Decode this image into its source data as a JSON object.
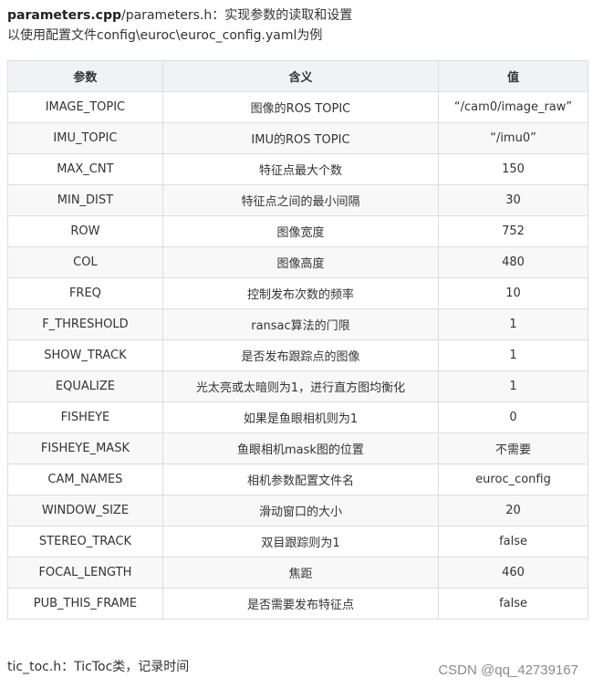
{
  "intro": {
    "file_bold": "parameters.cpp",
    "file_rest": "/parameters.h",
    "desc": "：实现参数的读取和设置",
    "line2": "以使用配置文件config\\euroc\\euroc_config.yaml为例"
  },
  "table": {
    "headers": [
      "参数",
      "含义",
      "值"
    ],
    "rows": [
      [
        "IMAGE_TOPIC",
        "图像的ROS TOPIC",
        "“/cam0/image_raw”"
      ],
      [
        "IMU_TOPIC",
        "IMU的ROS TOPIC",
        "“/imu0”"
      ],
      [
        "MAX_CNT",
        "特征点最大个数",
        "150"
      ],
      [
        "MIN_DIST",
        "特征点之间的最小间隔",
        "30"
      ],
      [
        "ROW",
        "图像宽度",
        "752"
      ],
      [
        "COL",
        "图像高度",
        "480"
      ],
      [
        "FREQ",
        "控制发布次数的频率",
        "10"
      ],
      [
        "F_THRESHOLD",
        "ransac算法的门限",
        "1"
      ],
      [
        "SHOW_TRACK",
        "是否发布跟踪点的图像",
        "1"
      ],
      [
        "EQUALIZE",
        "光太亮或太暗则为1，进行直方图均衡化",
        "1"
      ],
      [
        "FISHEYE",
        "如果是鱼眼相机则为1",
        "0"
      ],
      [
        "FISHEYE_MASK",
        "鱼眼相机mask图的位置",
        "不需要"
      ],
      [
        "CAM_NAMES",
        "相机参数配置文件名",
        "euroc_config"
      ],
      [
        "WINDOW_SIZE",
        "滑动窗口的大小",
        "20"
      ],
      [
        "STEREO_TRACK",
        "双目跟踪则为1",
        "false"
      ],
      [
        "FOCAL_LENGTH",
        "焦距",
        "460"
      ],
      [
        "PUB_THIS_FRAME",
        "是否需要发布特征点",
        "false"
      ]
    ]
  },
  "footer": {
    "text": "tic_toc.h：TicToc类，记录时间"
  },
  "watermark": {
    "text": "CSDN @qq_42739167"
  }
}
